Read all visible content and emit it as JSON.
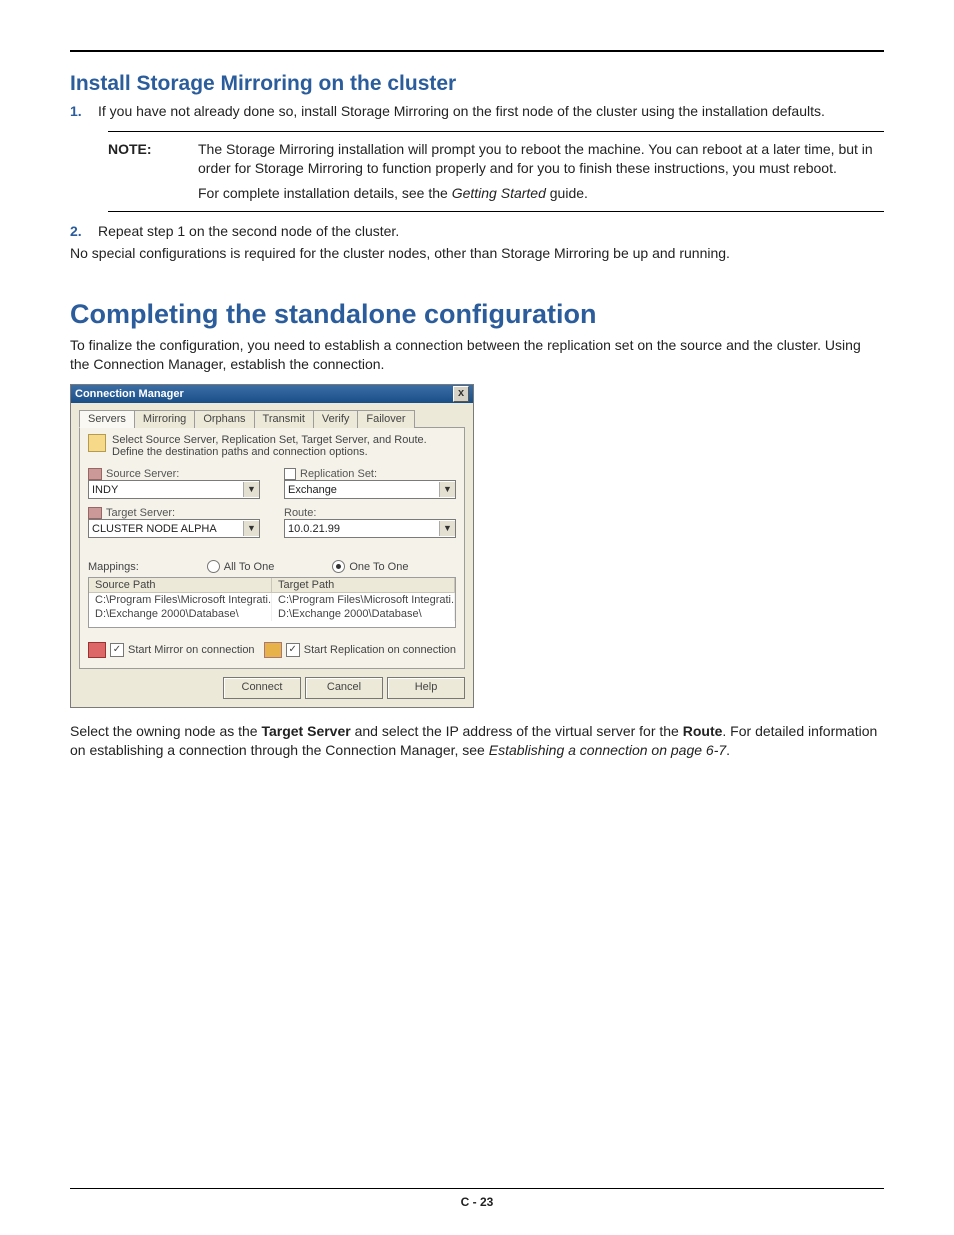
{
  "headings": {
    "h3": "Install Storage Mirroring on the cluster",
    "h2": "Completing the standalone configuration"
  },
  "list1": {
    "num1": "1.",
    "text1": "If you have not already done so, install Storage Mirroring on the first node of the cluster using the installation defaults.",
    "num2": "2.",
    "text2": "Repeat step 1 on the second node of the cluster."
  },
  "note": {
    "label": "NOTE:",
    "line1": "The Storage Mirroring installation will prompt you to reboot the machine. You can reboot at a later time, but in order for Storage Mirroring to function properly and for you to finish these instructions, you must reboot.",
    "line2a": "For complete installation details, see the ",
    "line2b": "Getting Started",
    "line2c": " guide."
  },
  "para2": "No special configurations is required for the cluster nodes, other than Storage Mirroring be up and running.",
  "para3": "To finalize the configuration, you need to establish a connection between the replication set on the source and the cluster. Using the Connection Manager, establish the connection.",
  "dialog": {
    "title": "Connection Manager",
    "close": "x",
    "tabs": [
      "Servers",
      "Mirroring",
      "Orphans",
      "Transmit",
      "Verify",
      "Failover"
    ],
    "instr": "Select Source Server, Replication Set, Target Server, and Route. Define the destination paths and connection options.",
    "labels": {
      "source": "Source Server:",
      "replset": "Replication Set:",
      "target": "Target Server:",
      "route": "Route:"
    },
    "values": {
      "source": "INDY",
      "replset": "Exchange",
      "target": "CLUSTER NODE ALPHA",
      "route": "10.0.21.99"
    },
    "mappings": {
      "label": "Mappings:",
      "radio1": "All To One",
      "radio2": "One To One"
    },
    "table": {
      "head1": "Source Path",
      "head2": "Target Path",
      "r1c1": "C:\\Program Files\\Microsoft Integrati...",
      "r1c2": "C:\\Program Files\\Microsoft Integrati...",
      "r2c1": "D:\\Exchange 2000\\Database\\",
      "r2c2": "D:\\Exchange 2000\\Database\\"
    },
    "checks": {
      "mirror": "Start Mirror on connection",
      "repl": "Start Replication on connection"
    },
    "buttons": {
      "connect": "Connect",
      "cancel": "Cancel",
      "help": "Help"
    }
  },
  "para4a": "Select the owning node as the ",
  "para4b": "Target Server",
  "para4c": " and select the IP address of the virtual server for the ",
  "para4d": "Route",
  "para4e": ". For detailed information on establishing a connection through the Connection Manager, see ",
  "para4f": "Establishing a connection on page 6-7",
  "para4g": ".",
  "footer": "C - 23"
}
